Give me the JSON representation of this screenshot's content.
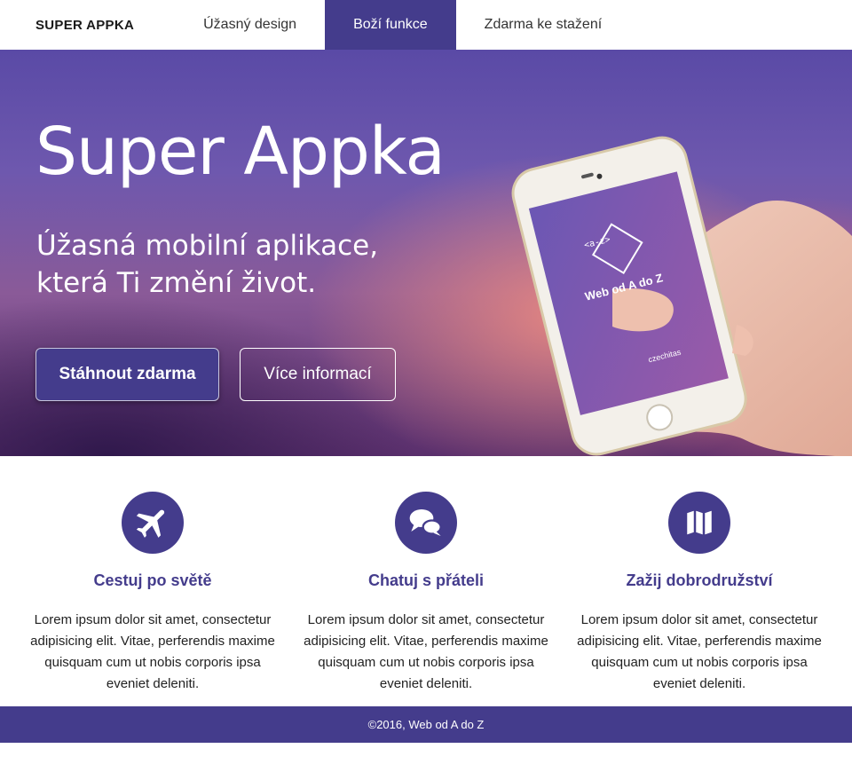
{
  "nav": {
    "brand": "SUPER APPKA",
    "items": [
      {
        "label": "Úžasný design",
        "active": false
      },
      {
        "label": "Boží funkce",
        "active": true
      },
      {
        "label": "Zdarma ke stažení",
        "active": false
      }
    ]
  },
  "hero": {
    "title": "Super Appka",
    "subtitle_line1": "Úžasná mobilní aplikace,",
    "subtitle_line2": "která Ti změní život.",
    "primary_button": "Stáhnout zdarma",
    "secondary_button": "Více informací",
    "phone_screen": {
      "logo_text": "<a-z>",
      "title": "Web od A do Z",
      "brand": "czechitas"
    }
  },
  "features": [
    {
      "icon": "plane-icon",
      "title": "Cestuj po světě",
      "text": "Lorem ipsum dolor sit amet, consectetur adipisicing elit. Vitae, perferendis maxime quisquam cum ut nobis corporis ipsa eveniet deleniti."
    },
    {
      "icon": "chat-icon",
      "title": "Chatuj s přáteli",
      "text": "Lorem ipsum dolor sit amet, consectetur adipisicing elit. Vitae, perferendis maxime quisquam cum ut nobis corporis ipsa eveniet deleniti."
    },
    {
      "icon": "map-icon",
      "title": "Zažij dobrodružství",
      "text": "Lorem ipsum dolor sit amet, consectetur adipisicing elit. Vitae, perferendis maxime quisquam cum ut nobis corporis ipsa eveniet deleniti."
    }
  ],
  "footer": {
    "text": "©2016, Web od A do Z"
  },
  "colors": {
    "accent": "#443c8c",
    "white": "#ffffff"
  }
}
